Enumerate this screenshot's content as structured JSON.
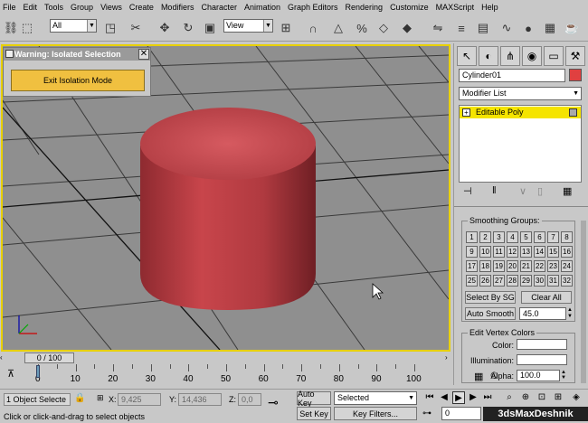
{
  "menu": [
    "File",
    "Edit",
    "Tools",
    "Group",
    "Views",
    "Create",
    "Modifiers",
    "Character",
    "Animation",
    "Graph Editors",
    "Rendering",
    "Customize",
    "MAXScript",
    "Help"
  ],
  "toolbar": {
    "selection_filter": "All",
    "reference_coord": "View",
    "icons": [
      "undo-icon",
      "redo-icon",
      "select-link-icon",
      "unlink-icon",
      "bind-spacewarp-icon",
      "select-object-icon",
      "select-by-name-icon",
      "rect-selection-icon",
      "window-crossing-icon",
      "select-move-icon",
      "select-rotate-icon",
      "select-scale-icon",
      "pivot-icon",
      "mirror-icon",
      "align-icon",
      "layer-icon",
      "curve-editor-icon",
      "schematic-icon",
      "material-editor-icon",
      "render-scene-icon",
      "quick-render-icon"
    ]
  },
  "viewport": {
    "warning_title": "Warning: Isolated Selection",
    "exit_button": "Exit Isolation Mode",
    "object_color": "#b2393e",
    "border_color": "#e8d000"
  },
  "command_panel": {
    "object_name": "Cylinder01",
    "object_color": "#e04040",
    "modifier_list_label": "Modifier List",
    "stack_item": "Editable Poly",
    "smoothing_groups_title": "Smoothing Groups:",
    "smoothing_numbers": [
      "1",
      "2",
      "3",
      "4",
      "5",
      "6",
      "7",
      "8",
      "9",
      "10",
      "11",
      "12",
      "13",
      "14",
      "15",
      "16",
      "17",
      "18",
      "19",
      "20",
      "21",
      "22",
      "23",
      "24",
      "25",
      "26",
      "27",
      "28",
      "29",
      "30",
      "31",
      "32"
    ],
    "select_by_sg": "Select By SG",
    "clear_all": "Clear All",
    "auto_smooth_label": "Auto Smooth",
    "auto_smooth_value": "45.0",
    "vertex_colors_title": "Edit Vertex Colors",
    "color_label": "Color:",
    "illumination_label": "Illumination:",
    "alpha_label": "Alpha:",
    "alpha_value": "100.0"
  },
  "timeline": {
    "frame_display": "0 / 100",
    "ticks": [
      "0",
      "10",
      "20",
      "30",
      "40",
      "50",
      "60",
      "70",
      "80",
      "90",
      "100"
    ]
  },
  "status": {
    "selection_info": "1 Object Selecte",
    "x_label": "X:",
    "x_value": "9,425",
    "y_label": "Y:",
    "y_value": "14,436",
    "z_label": "Z:",
    "z_value": "0,0",
    "prompt": "Click or click-and-drag to select objects",
    "auto_key": "Auto Key",
    "set_key": "Set Key",
    "key_mode": "Selected",
    "key_filters": "Key Filters...",
    "current_frame": "0",
    "watermark": "3dsMaxDeshnik"
  }
}
